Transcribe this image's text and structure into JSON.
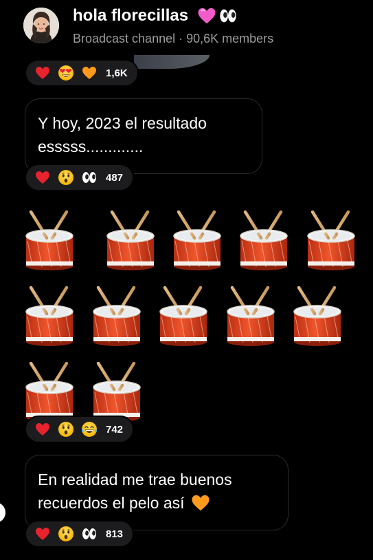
{
  "channel": {
    "name": "hola florecillas",
    "subtitle": "Broadcast channel · 90,6K members",
    "title_emojis": [
      "pink-heart-icon",
      "eyes-icon"
    ]
  },
  "messages": [
    {
      "id": "m0",
      "type": "media",
      "reactions": {
        "icons": [
          "red-heart-icon",
          "heart-eyes-face-icon",
          "orange-heart-icon"
        ],
        "count": "1,6K"
      }
    },
    {
      "id": "m1",
      "type": "text",
      "lines": [
        "Y hoy, 2023 el resultado",
        "esssss............."
      ],
      "reactions": {
        "icons": [
          "red-heart-icon",
          "astonished-face-icon",
          "eyes-icon"
        ],
        "count": "487"
      }
    },
    {
      "id": "m2",
      "type": "emoji",
      "emoji": "drum-icon",
      "emoji_count": 12,
      "reactions": {
        "icons": [
          "red-heart-icon",
          "astonished-face-icon",
          "tears-of-joy-face-icon"
        ],
        "count": "742"
      }
    },
    {
      "id": "m3",
      "type": "text",
      "lines": [
        "En realidad me trae buenos",
        "recuerdos el pelo así"
      ],
      "trailing_emoji": "orange-heart-icon",
      "reactions": {
        "icons": [
          "red-heart-icon",
          "astonished-face-icon",
          "eyes-icon"
        ],
        "count": "813"
      }
    }
  ]
}
